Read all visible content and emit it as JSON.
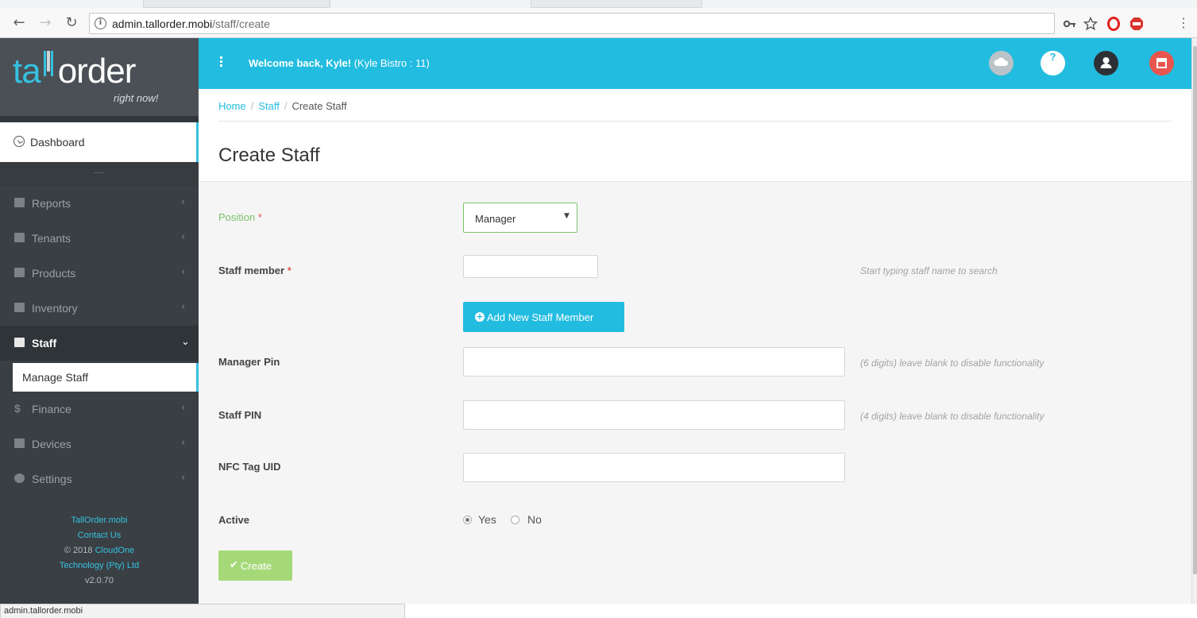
{
  "browser": {
    "url_host": "admin.tallorder.mobi",
    "url_path": "/staff/create",
    "status_url": "admin.tallorder.mobi"
  },
  "logo": {
    "word_left": "ta",
    "word_right": "order",
    "tagline": "right now!"
  },
  "sidebar": {
    "dashboard": "Dashboard",
    "items": [
      {
        "label": "Reports"
      },
      {
        "label": "Tenants"
      },
      {
        "label": "Products"
      },
      {
        "label": "Inventory"
      },
      {
        "label": "Staff"
      },
      {
        "label": "Finance"
      },
      {
        "label": "Devices"
      },
      {
        "label": "Settings"
      }
    ],
    "submenu": "Manage Staff",
    "footer": {
      "site": "TallOrder.mobi",
      "contact": "Contact Us",
      "copyright": "© 2018",
      "company_link": "CloudOne",
      "company_rest": "Technology (Pty) Ltd",
      "version": "v2.0.70"
    }
  },
  "header": {
    "welcome_bold": "Welcome back, Kyle!",
    "welcome_rest": " (Kyle Bistro : 11)",
    "help_glyph": "?"
  },
  "breadcrumb": {
    "home": "Home",
    "staff": "Staff",
    "current": "Create Staff",
    "sep": "/"
  },
  "page": {
    "title": "Create Staff"
  },
  "form": {
    "position_label": "Position",
    "position_value": "Manager",
    "staff_member_label": "Staff member",
    "staff_member_help": "Start typing staff name to search",
    "add_button": "Add New Staff Member",
    "manager_pin_label": "Manager Pin",
    "manager_pin_help": "(6 digits) leave blank to disable functionality",
    "staff_pin_label": "Staff PIN",
    "staff_pin_help": "(4 digits) leave blank to disable functionality",
    "nfc_label": "NFC Tag UID",
    "active_label": "Active",
    "yes": "Yes",
    "no": "No",
    "create_button": "Create",
    "required_mark": "*"
  },
  "colors": {
    "accent": "#22bce0",
    "sidebar_bg": "#3a3f44",
    "success": "#a5d978",
    "required": "#e05a5a"
  },
  "icons": [
    "back-icon",
    "forward-icon",
    "reload-icon",
    "info-icon",
    "key-icon",
    "star-icon",
    "opera-icon",
    "adblock-icon",
    "kebab-icon",
    "dashboard-icon",
    "reports-icon",
    "tenants-icon",
    "products-icon",
    "inventory-icon",
    "staff-icon",
    "finance-icon",
    "devices-icon",
    "settings-icon",
    "cloud-icon",
    "help-icon",
    "user-icon",
    "store-icon"
  ]
}
